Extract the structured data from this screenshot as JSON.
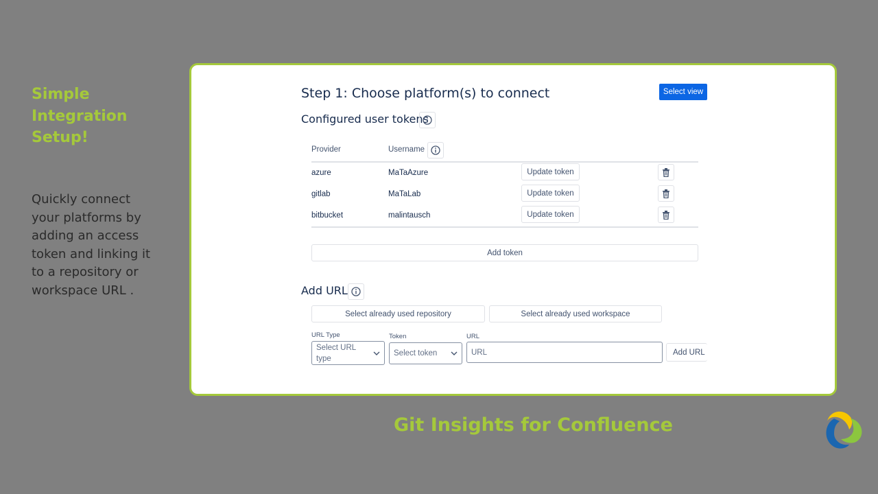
{
  "side": {
    "title": "Simple Integration Setup!",
    "body": "Quickly connect your platforms by adding an access token and linking it to a repository or workspace URL ."
  },
  "footer": "Git Insights for Confluence",
  "card": {
    "step_title": "Step 1: Choose platform(s) to connect",
    "select_view": "Select view",
    "tokens_title": "Configured user tokens",
    "headers": {
      "provider": "Provider",
      "username": "Username"
    },
    "rows": [
      {
        "provider": "azure",
        "username": "MaTaAzure",
        "action": "Update token"
      },
      {
        "provider": "gitlab",
        "username": "MaTaLab",
        "action": "Update token"
      },
      {
        "provider": "bitbucket",
        "username": "malintausch",
        "action": "Update token"
      }
    ],
    "add_token": "Add token",
    "add_url_title": "Add URL",
    "select_repo": "Select already used repository",
    "select_workspace": "Select already used workspace",
    "url_type_label": "URL Type",
    "url_type_placeholder": "Select URL type",
    "token_label": "Token",
    "token_placeholder": "Select token",
    "url_label": "URL",
    "url_placeholder": "URL",
    "add_url_button": "Add URL"
  },
  "colors": {
    "accent": "#a5c93b",
    "primary": "#0c66e4"
  }
}
